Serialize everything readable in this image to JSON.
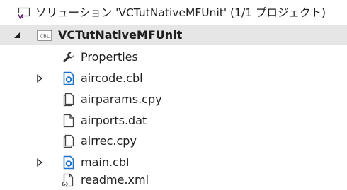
{
  "solution_explorer": {
    "solution": {
      "label": "ソリューション 'VCTutNativeMFUnit' (1/1 プロジェクト)",
      "icon": "solution-icon"
    },
    "project": {
      "label": "VCTutNativeMFUnit",
      "icon": "cobol-project-icon",
      "icon_text": "CBL",
      "expanded": true
    },
    "items": [
      {
        "label": "Properties",
        "icon": "wrench-icon",
        "expandable": false
      },
      {
        "label": "aircode.cbl",
        "icon": "cobol-source-file-icon",
        "expandable": true
      },
      {
        "label": "airparams.cpy",
        "icon": "copybook-file-icon",
        "expandable": false
      },
      {
        "label": "airports.dat",
        "icon": "data-file-icon",
        "expandable": false
      },
      {
        "label": "airrec.cpy",
        "icon": "copybook-file-icon",
        "expandable": false
      },
      {
        "label": "main.cbl",
        "icon": "cobol-source-file-icon",
        "expandable": true
      },
      {
        "label": "readme.xml",
        "icon": "xml-file-icon",
        "expandable": false
      }
    ]
  },
  "colors": {
    "selected_row_bg": "#e6e6e6",
    "cobol_icon_blue": "#1e73c8",
    "visual_studio_purple": "#68217a",
    "text": "#1e1e1e"
  }
}
